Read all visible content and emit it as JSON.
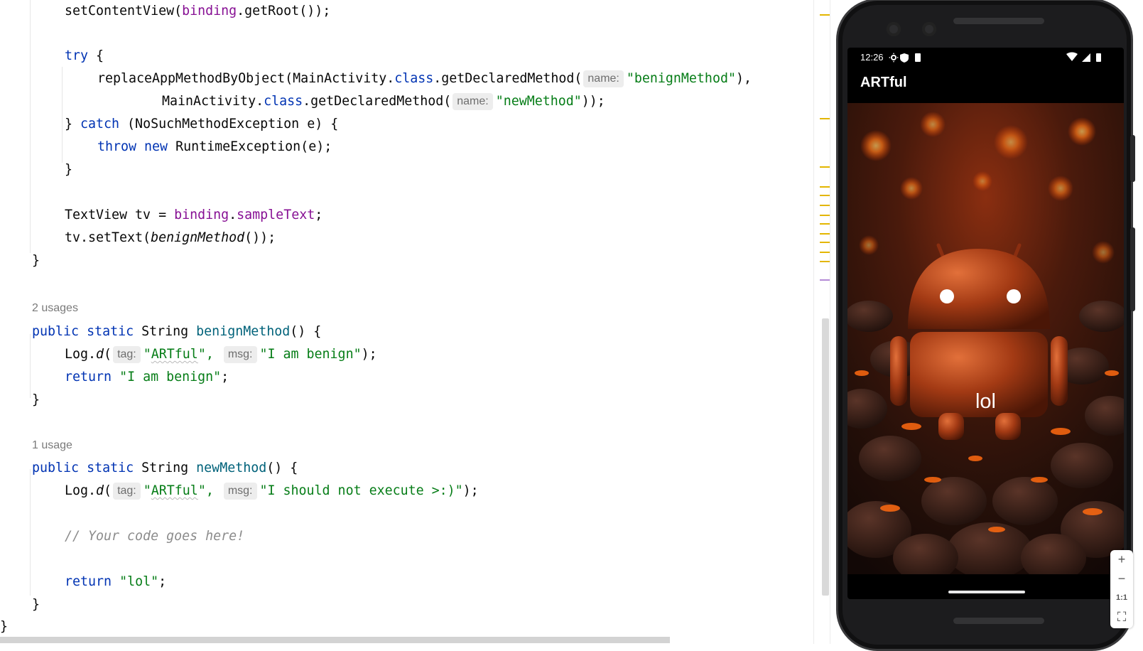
{
  "editor": {
    "line1": [
      "setContentView(",
      "binding",
      ".getRoot());"
    ],
    "line2": [
      "try",
      " {"
    ],
    "line3": [
      "replaceAppMethodByObject(MainActivity.",
      "class",
      ".getDeclaredMethod(",
      "name:",
      "\"benignMethod\"",
      "),"
    ],
    "line4": [
      "MainActivity.",
      "class",
      ".getDeclaredMethod(",
      "name:",
      "\"newMethod\"",
      "));"
    ],
    "line5": [
      "} ",
      "catch",
      " (NoSuchMethodException e) {"
    ],
    "line6": [
      "throw",
      " ",
      "new",
      " RuntimeException(e);"
    ],
    "line7": "}",
    "line8": [
      "TextView tv = ",
      "binding",
      ".",
      "sampleText",
      ";"
    ],
    "line9": [
      "tv.setText(",
      "benignMethod",
      "());"
    ],
    "line10": "}",
    "usages1": "2 usages",
    "line11": [
      "public",
      " ",
      "static",
      " String ",
      "benignMethod",
      "() {"
    ],
    "line12": [
      "Log.",
      "d",
      "(",
      "tag:",
      "\"",
      "ARTful",
      "\",",
      "msg:",
      "\"I am benign\"",
      ");"
    ],
    "line13": [
      "return",
      " ",
      "\"I am benign\"",
      ";"
    ],
    "line14": "}",
    "usages2": "1 usage",
    "line15": [
      "public",
      " ",
      "static",
      " String ",
      "newMethod",
      "() {"
    ],
    "line16": [
      "Log.",
      "d",
      "(",
      "tag:",
      "\"",
      "ARTful",
      "\",",
      "msg:",
      "\"I should not execute >:)\"",
      ");"
    ],
    "line17": "// Your code goes here!",
    "line18": [
      "return",
      " ",
      "\"lol\"",
      ";"
    ],
    "line19": "}",
    "line20": "}"
  },
  "emulator": {
    "status_time": "12:26",
    "app_title": "ARTful",
    "center_text": "lol",
    "zoom_buttons": [
      "+",
      "−",
      "1:1",
      "⛶"
    ]
  },
  "colors": {
    "keyword": "#0033b3",
    "field": "#871094",
    "string": "#067d17",
    "method": "#00627a",
    "comment": "#8c8c8c",
    "stripe_warning": "#e3b600"
  }
}
